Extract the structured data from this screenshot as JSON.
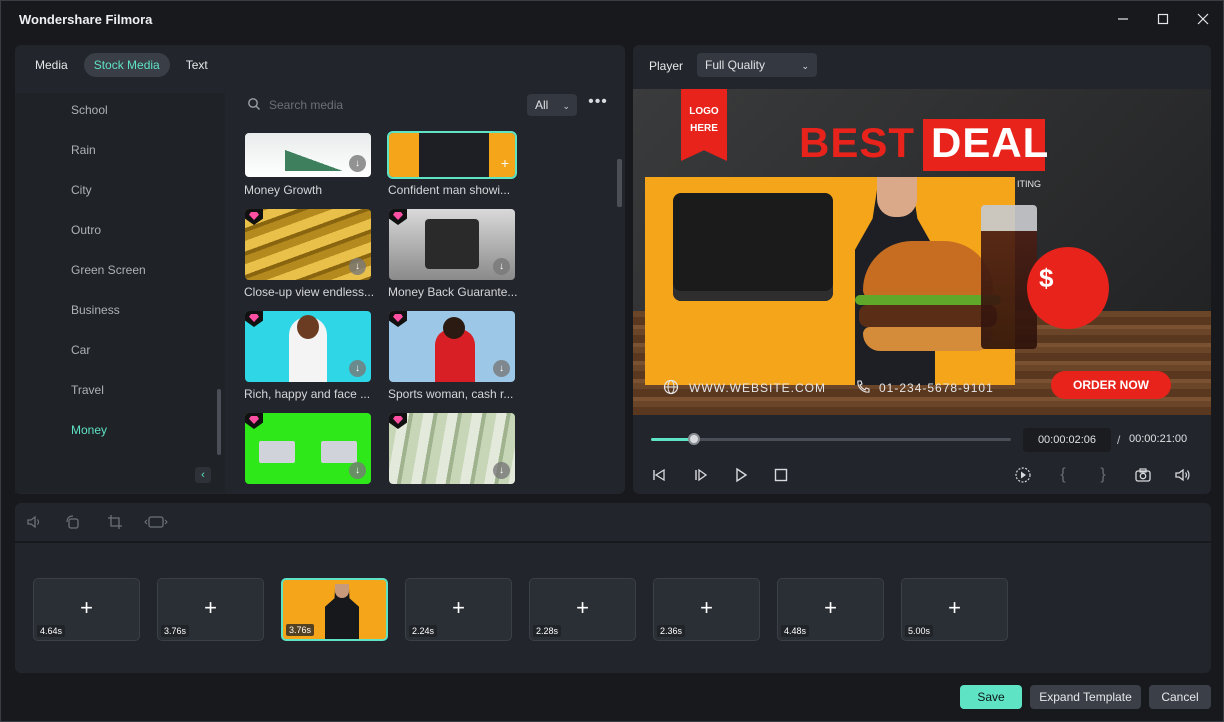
{
  "app": {
    "title": "Wondershare Filmora"
  },
  "media_panel": {
    "tabs": [
      {
        "label": "Media"
      },
      {
        "label": "Stock Media"
      },
      {
        "label": "Text"
      }
    ],
    "categories": [
      {
        "label": "School"
      },
      {
        "label": "Rain"
      },
      {
        "label": "City"
      },
      {
        "label": "Outro"
      },
      {
        "label": "Green Screen"
      },
      {
        "label": "Business"
      },
      {
        "label": "Car"
      },
      {
        "label": "Travel"
      },
      {
        "label": "Money"
      }
    ],
    "active_category": "Money",
    "search": {
      "placeholder": "Search media",
      "value": ""
    },
    "filter": {
      "selected": "All"
    },
    "items": [
      {
        "label": "Money Growth",
        "premium": false
      },
      {
        "label": "Confident man showi...",
        "premium": false
      },
      {
        "label": "Close-up view endless...",
        "premium": true
      },
      {
        "label": "Money Back Guarante...",
        "premium": true
      },
      {
        "label": "Rich, happy and face ...",
        "premium": true
      },
      {
        "label": "Sports woman, cash r...",
        "premium": true
      },
      {
        "label": "",
        "premium": true
      },
      {
        "label": "",
        "premium": true
      }
    ]
  },
  "player": {
    "label": "Player",
    "quality": "Full Quality",
    "preview": {
      "logo": [
        "LOGO",
        "HERE"
      ],
      "headline_1": "BEST",
      "headline_2": "DEAL",
      "partial_text": "ITING",
      "website": "WWW.WEBSITE.COM",
      "phone": "01-234-5678-9101",
      "circle_text": "$",
      "cta": "ORDER NOW"
    },
    "current_time": "00:00:02:06",
    "separator": "/",
    "total_time": "00:00:21:00",
    "progress": 0.12
  },
  "timeline": {
    "slots": [
      {
        "duration": "4.64s"
      },
      {
        "duration": "3.76s"
      },
      {
        "duration": "3.76s"
      },
      {
        "duration": "2.24s"
      },
      {
        "duration": "2.28s"
      },
      {
        "duration": "2.36s"
      },
      {
        "duration": "4.48s"
      },
      {
        "duration": "5.00s"
      }
    ],
    "plus_glyph": "+"
  },
  "actions": {
    "save": "Save",
    "expand": "Expand Template",
    "cancel": "Cancel"
  },
  "colors": {
    "accent": "#5fe3c5",
    "background": "#17191d",
    "panel": "#22252b",
    "brand_red": "#e8231b"
  }
}
